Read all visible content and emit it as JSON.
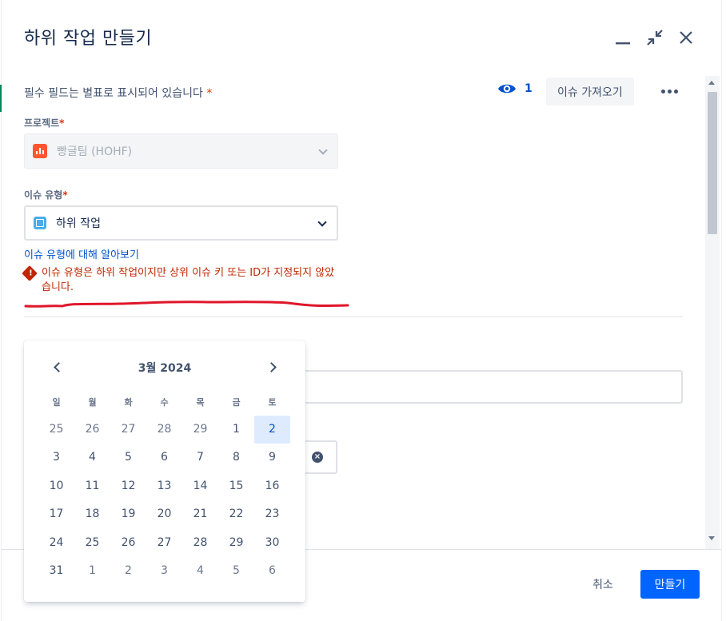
{
  "modal": {
    "title": "하위 작업 만들기",
    "required_note": "필수 필드는 별표로 표시되어 있습니다",
    "required_mark": "*",
    "watchers_count": "1",
    "import_label": "이슈 가져오기"
  },
  "project": {
    "label": "프로젝트",
    "value": "빵글팀 (HOHF)"
  },
  "issue_type": {
    "label": "이슈 유형",
    "value": "하위 작업",
    "learn_more": "이슈 유형에 대해 알아보기",
    "error": "이슈 유형은 하위 작업이지만 상위 이슈 키 또는 ID가 지정되지 않았습니다."
  },
  "calendar": {
    "title": "3월 2024",
    "weekdays": [
      "일",
      "월",
      "화",
      "수",
      "목",
      "금",
      "토"
    ],
    "weeks": [
      [
        "25",
        "26",
        "27",
        "28",
        "29",
        "1",
        "2"
      ],
      [
        "3",
        "4",
        "5",
        "6",
        "7",
        "8",
        "9"
      ],
      [
        "10",
        "11",
        "12",
        "13",
        "14",
        "15",
        "16"
      ],
      [
        "17",
        "18",
        "19",
        "20",
        "21",
        "22",
        "23"
      ],
      [
        "24",
        "25",
        "26",
        "27",
        "28",
        "29",
        "30"
      ],
      [
        "31",
        "1",
        "2",
        "3",
        "4",
        "5",
        "6"
      ]
    ],
    "selected": "2"
  },
  "footer": {
    "cancel_label": "취소",
    "create_label": "만들기"
  },
  "colors": {
    "primary": "#0065ff",
    "error": "#bf2600",
    "annotation": "#e0162b"
  }
}
